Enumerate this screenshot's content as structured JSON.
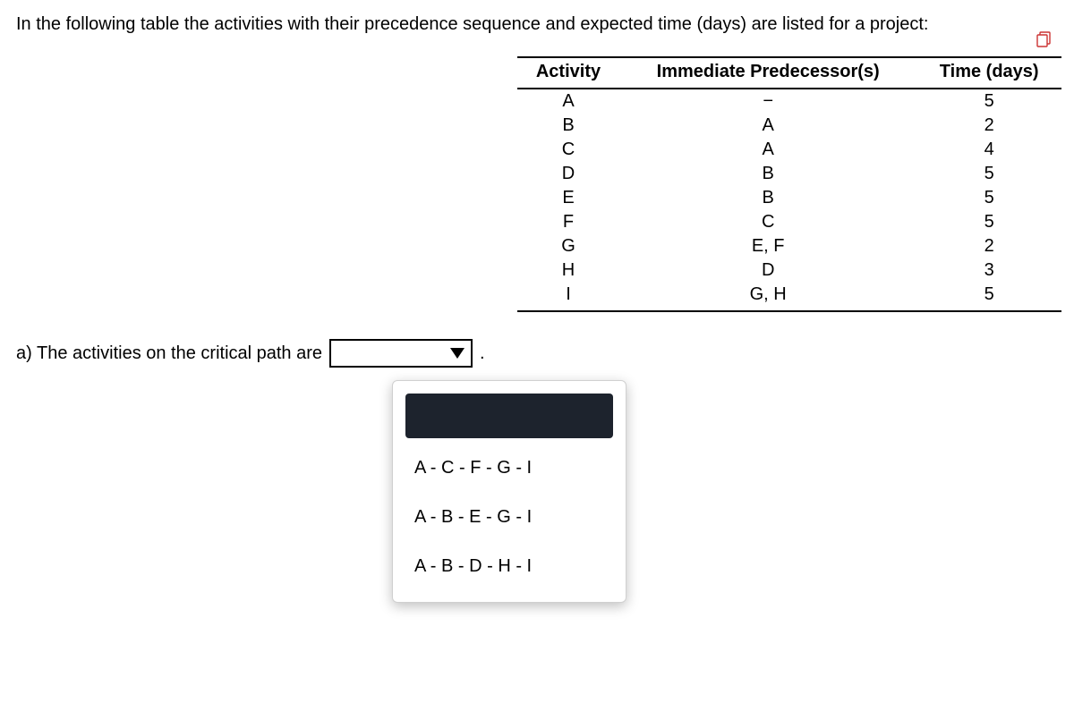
{
  "intro": "In the following table the activities with their precedence sequence and expected time (days) are listed for a project:",
  "table": {
    "headers": [
      "Activity",
      "Immediate Predecessor(s)",
      "Time (days)"
    ],
    "rows": [
      {
        "activity": "A",
        "pred": "−",
        "time": "5"
      },
      {
        "activity": "B",
        "pred": "A",
        "time": "2"
      },
      {
        "activity": "C",
        "pred": "A",
        "time": "4"
      },
      {
        "activity": "D",
        "pred": "B",
        "time": "5"
      },
      {
        "activity": "E",
        "pred": "B",
        "time": "5"
      },
      {
        "activity": "F",
        "pred": "C",
        "time": "5"
      },
      {
        "activity": "G",
        "pred": "E, F",
        "time": "2"
      },
      {
        "activity": "H",
        "pred": "D",
        "time": "3"
      },
      {
        "activity": "I",
        "pred": "G, H",
        "time": "5"
      }
    ]
  },
  "question": {
    "label": "a) The activities on the critical path are",
    "after": "."
  },
  "options": [
    "",
    "A - C - F - G - I",
    "A - B - E - G - I",
    "A - B - D - H - I"
  ]
}
